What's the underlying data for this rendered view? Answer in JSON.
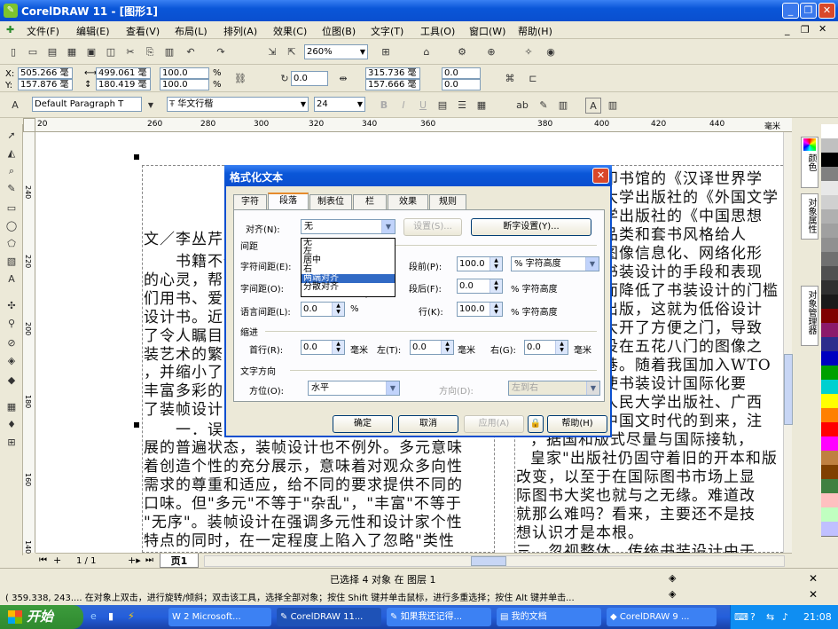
{
  "window": {
    "title": "CorelDRAW 11 - [图形1]",
    "controls": [
      "_",
      "❐",
      "✕"
    ]
  },
  "menu": [
    "文件(F)",
    "编辑(E)",
    "查看(V)",
    "布局(L)",
    "排列(A)",
    "效果(C)",
    "位图(B)",
    "文字(T)",
    "工具(O)",
    "窗口(W)",
    "帮助(H)"
  ],
  "toolbar": {
    "zoom": "260%"
  },
  "propbar": {
    "x": "505.266 毫",
    "y": "157.876 毫",
    "w": "499.061 毫",
    "h": "180.419 毫",
    "scale_x": "100.0",
    "scale_y": "100.0",
    "pct": "%",
    "angle": "0.0",
    "pos2_x": "315.736 毫",
    "pos2_y": "157.666 毫",
    "dup_x": "0.0",
    "dup_y": "0.0"
  },
  "textbar": {
    "style": "Default Paragraph T",
    "font": "华文行楷",
    "size": "24"
  },
  "ruler": {
    "top": [
      "20",
      "260",
      "280",
      "300",
      "320",
      "340",
      "360",
      "380",
      "400",
      "420",
      "440",
      "毫米"
    ],
    "left": [
      "240",
      "220",
      "200",
      "180",
      "160",
      "140"
    ]
  },
  "document": {
    "left_col": [
      "文／李丛芹",
      "　　书籍不仅",
      "的心灵，帮",
      "们用书、爱",
      "设计书。近",
      "了令人瞩目",
      "装艺术的繁",
      "，并缩小了",
      "丰富多彩的",
      "了装帧设计",
      "　　一．误",
      "展的普遍状态，装帧设计也不例外。多元意味",
      "着创造个性的充分展示，意味着对观众多向性",
      "需求的尊重和适应，给不同的要求提供不同的",
      "口味。但\"多元\"不等于\"杂乱\"，\"丰富\"不等于",
      "\"无序\"。装帧设计在强调多元性和设计家个性",
      "特点的同时，在一定程度上陷入了忽略\"类性"
    ],
    "right_col": [
      "印书馆的《汉译世界学",
      "大学出版社的《外国文学",
      "学出版社的《中国思想",
      "品类和套书风格给人",
      "图像信息化、网络化形",
      "书装设计的手段和表现",
      "而降低了书装设计的门槛",
      "出版，这就为低俗设计",
      "大开了方便之门，导致",
      "没在五花八门的图像之",
      "巷。随着我国加入WTO",
      "使书装设计国际化要",
      "人民大学出版社、广西",
      "中国文时代的到来，注",
      "，据国和版式尽量与国际接轨，",
      "皇家\"出版社仍固守着旧的开本和版",
      "改变，以至于在国际图书市场上显",
      "际图书大奖也就与之无缘。难道改",
      "就那么难吗？看来，主要还不是技",
      "想认识才是本根。",
      "三、忽视整体，传统书装设计由于"
    ]
  },
  "dialog": {
    "title": "格式化文本",
    "tabs": [
      "字符",
      "段落",
      "制表位",
      "栏",
      "效果",
      "规则"
    ],
    "align_label": "对齐(N):",
    "align_value": "无",
    "align_options": [
      "无",
      "左",
      "居中",
      "右",
      "两端对齐",
      "分散对齐"
    ],
    "align_selected": "两端对齐",
    "settings_btn": "设置(S)...",
    "hyphen_btn": "断字设置(Y)...",
    "spacing_heading": "间距",
    "char_spacing_label": "字符间距(E):",
    "word_spacing_label": "字间距(O):",
    "lang_spacing_label": "语言间距(L):",
    "lang_spacing_value": "0.0",
    "lang_spacing_unit": "%",
    "before_label": "段前(P):",
    "before_value": "100.0",
    "before_unit": "% 字符高度",
    "after_label": "段后(F):",
    "after_value": "0.0",
    "after_unit": "% 字符高度",
    "line_label": "行(K):",
    "line_value": "100.0",
    "line_unit": "% 字符高度",
    "indent_heading": "缩进",
    "first_label": "首行(R):",
    "first_value": "0.0",
    "first_unit": "毫米",
    "left_label": "左(T):",
    "left_value": "0.0",
    "left_unit": "毫米",
    "right_label": "右(G):",
    "right_value": "0.0",
    "right_unit": "毫米",
    "dir_heading": "文字方向",
    "orient_label": "方位(O):",
    "orient_value": "水平",
    "direction_label": "方向(D):",
    "direction_value": "左到右",
    "ok": "确定",
    "cancel": "取消",
    "apply": "应用(A)",
    "help": "帮助(H)"
  },
  "dockers": {
    "color": "颜色",
    "object_props": "对象属性",
    "object_mgr": "对象管理器"
  },
  "palette": [
    "#ffffff",
    "#c0c0c0",
    "#000000",
    "#808080",
    "#e8e8e8",
    "#d0d0d0",
    "#b0b0b0",
    "#a0a0a0",
    "#909090",
    "#707070",
    "#505050",
    "#303030",
    "#1a1a1a",
    "#7f0000",
    "#8b1a6b",
    "#2c2c8c",
    "#0000c0",
    "#00a000",
    "#00d0d0",
    "#ffff00",
    "#ff8000",
    "#ff0000",
    "#ff00ff",
    "#c08040",
    "#804000",
    "#408040",
    "#ffc0c0",
    "#c0ffc0",
    "#c0c0ff"
  ],
  "pagenav": {
    "current": "1 / 1",
    "tab": "页1"
  },
  "status": {
    "selection": "已选择 4 对象 在 图层 1",
    "hint": "( 359.338, 243.... 在对象上双击，进行旋转/倾斜；双击该工具，选择全部对象；按住 Shift 键并单击鼠标，进行多重选择；按住 Alt 键并单击..."
  },
  "taskbar": {
    "start": "开始",
    "tasks": [
      "2 Microsoft...",
      "CorelDRAW 11...",
      "如果我还记得...",
      "我的文档",
      "CorelDRAW 9 ..."
    ],
    "time": "21:08"
  }
}
